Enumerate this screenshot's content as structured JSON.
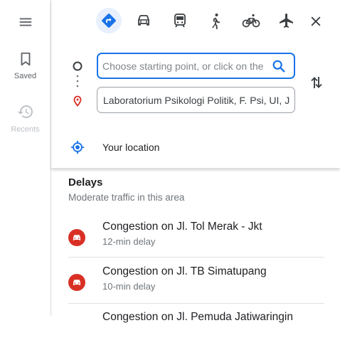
{
  "sidebar": {
    "menu_icon": "menu-icon",
    "saved_label": "Saved",
    "recents_label": "Recents"
  },
  "travel_modes": [
    {
      "name": "best-route",
      "icon": "diamond-directions-icon",
      "active": true
    },
    {
      "name": "driving",
      "icon": "car-icon",
      "active": false
    },
    {
      "name": "transit",
      "icon": "train-icon",
      "active": false
    },
    {
      "name": "walking",
      "icon": "walking-icon",
      "active": false
    },
    {
      "name": "cycling",
      "icon": "bicycle-icon",
      "active": false
    },
    {
      "name": "flights",
      "icon": "airplane-icon",
      "active": false
    }
  ],
  "directions": {
    "start_placeholder": "Choose starting point, or click on the map",
    "start_value": "",
    "destination_value": "Laboratorium Psikologi Politik, F. Psi, UI, Jl. Lkr. Kampus Raya"
  },
  "your_location_label": "Your location",
  "delays": {
    "title": "Delays",
    "subtitle": "Moderate traffic in this area",
    "items": [
      {
        "title": "Congestion on Jl. Tol Merak - Jkt",
        "delay": "12-min delay"
      },
      {
        "title": "Congestion on Jl. TB Simatupang",
        "delay": "10-min delay"
      },
      {
        "title": "Congestion on Jl. Pemuda Jatiwaringin",
        "delay": ""
      }
    ]
  },
  "colors": {
    "accent": "#1a73e8",
    "active_mode_bg": "#e8f0fe",
    "incident_red": "#d93025",
    "destination_pin": "#d93025"
  }
}
